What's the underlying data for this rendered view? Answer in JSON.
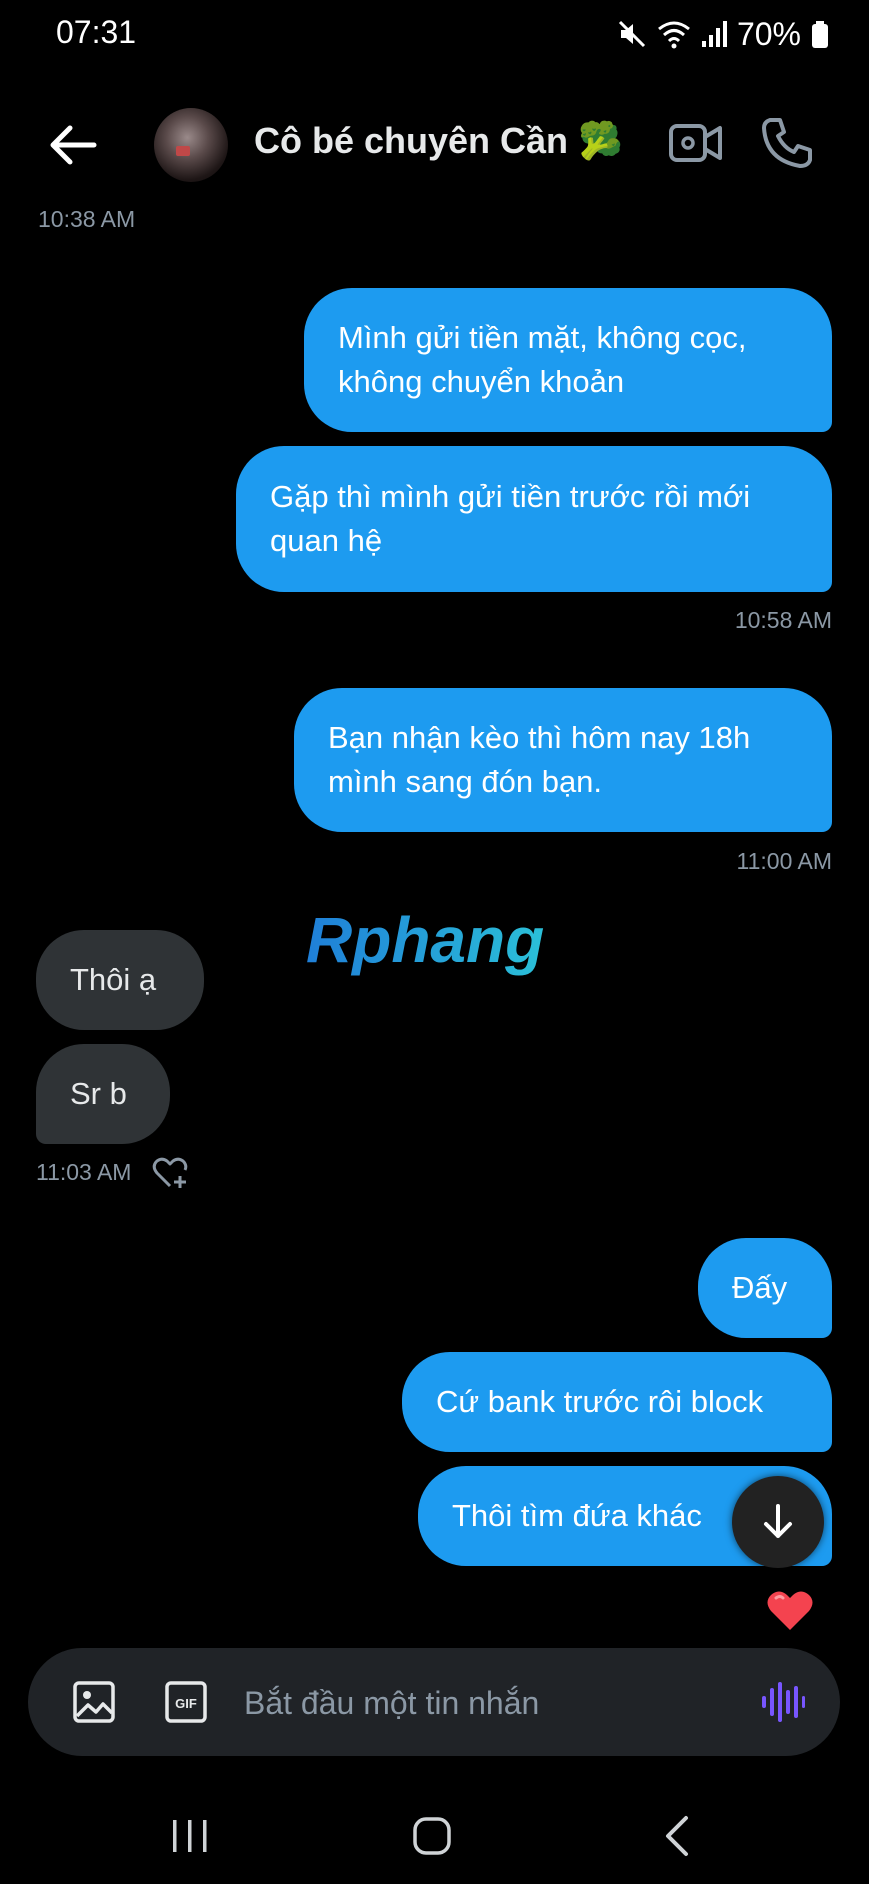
{
  "status_bar": {
    "time": "07:31",
    "battery": "70%"
  },
  "header": {
    "contact_name": "Cô bé chuyên Cần",
    "contact_emoji": "🥦"
  },
  "timestamps": {
    "t1": "10:38 AM",
    "t2": "10:58 AM",
    "t3": "11:00 AM",
    "t4": "11:03 AM"
  },
  "messages": {
    "m1": "Mình gửi tiền mặt, không cọc,\nkhông chuyển khoản",
    "m2": "Gặp thì mình gửi tiền trước rồi mới\nquan hệ",
    "m3": "Bạn nhận kèo thì hôm nay 18h\nmình sang đón bạn.",
    "m4": "Thôi ạ",
    "m5": "Sr b",
    "m6": "Đấy",
    "m7": "Cứ bank trước rôi block",
    "m8": "Thôi tìm đứa khác"
  },
  "watermark": "Rphang",
  "composer": {
    "placeholder": "Bắt đầu một tin nhắn"
  },
  "colors": {
    "accent": "#1d9bf0",
    "incoming_bubble": "#2f3336",
    "voice_icon": "#7856ff",
    "heart": "#f91880"
  },
  "icons": [
    "back-arrow-icon",
    "video-call-icon",
    "phone-call-icon",
    "heart-plus-icon",
    "heart-icon",
    "arrow-down-icon",
    "image-icon",
    "gif-icon",
    "voice-wave-icon"
  ]
}
